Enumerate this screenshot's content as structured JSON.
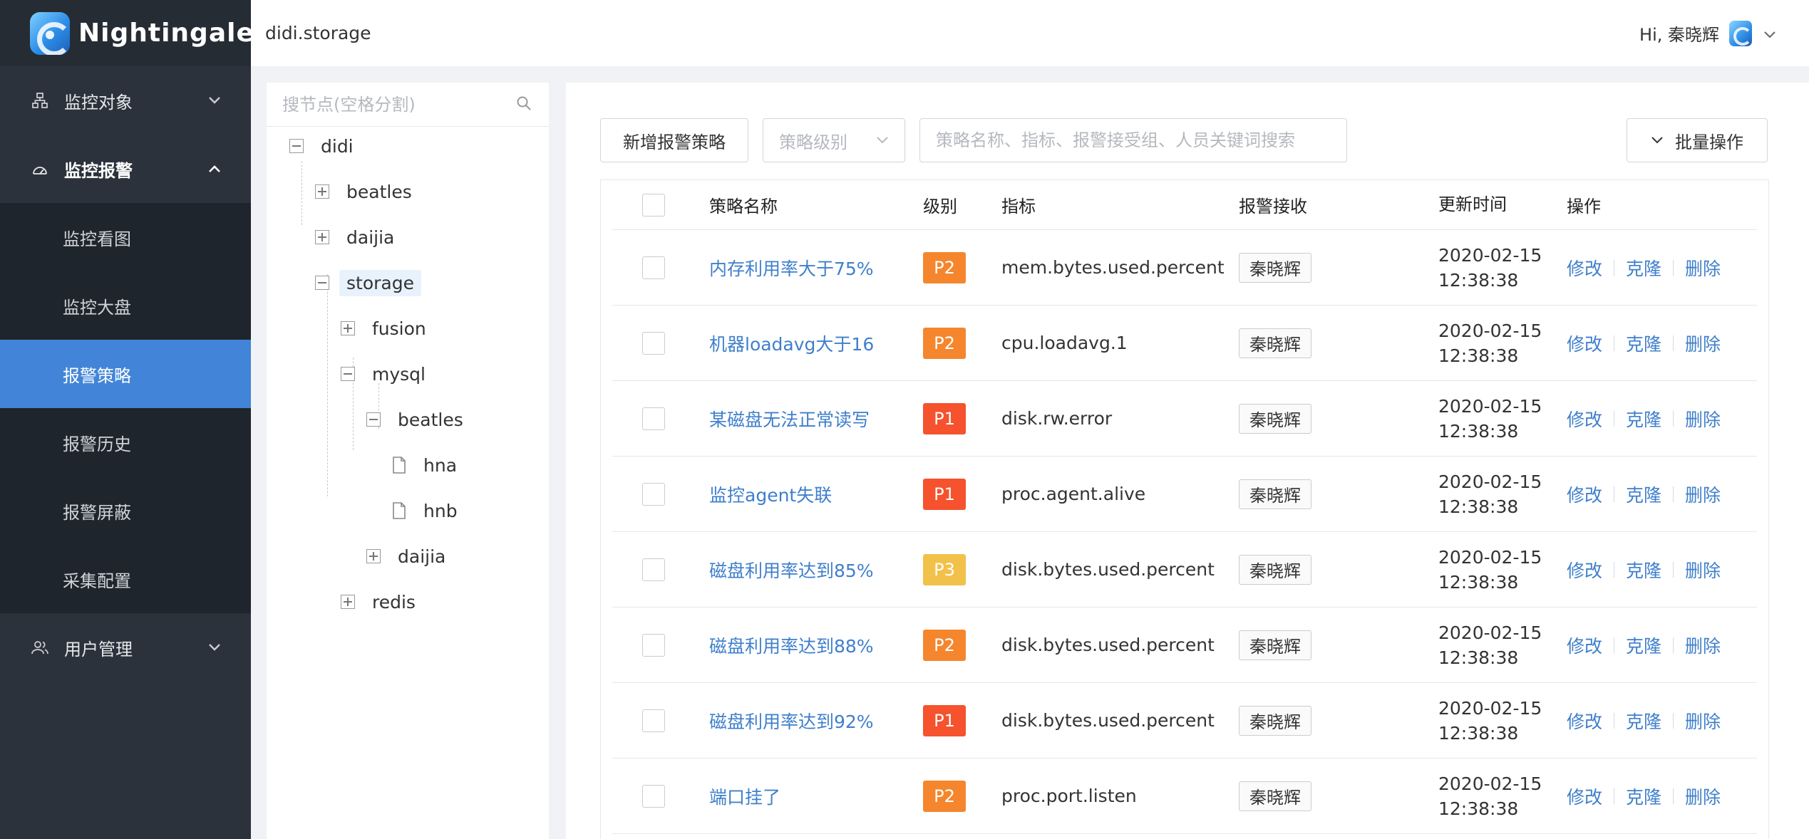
{
  "app": {
    "name": "Nightingale"
  },
  "header": {
    "breadcrumb": "didi.storage",
    "greeting": "Hi, 秦晓辉"
  },
  "sidebar": {
    "groups": [
      {
        "label": "监控对象",
        "icon": "sitemap-icon",
        "expanded": false
      },
      {
        "label": "监控报警",
        "icon": "dashboard-gauge-icon",
        "expanded": true,
        "items": [
          "监控看图",
          "监控大盘",
          "报警策略",
          "报警历史",
          "报警屏蔽",
          "采集配置"
        ],
        "active_item": "报警策略"
      },
      {
        "label": "用户管理",
        "icon": "users-icon",
        "expanded": false
      }
    ]
  },
  "tree": {
    "search_placeholder": "搜节点(空格分割)",
    "nodes": [
      {
        "label": "didi",
        "type": "expanded"
      },
      {
        "label": "beatles",
        "type": "collapsed"
      },
      {
        "label": "daijia",
        "type": "collapsed"
      },
      {
        "label": "storage",
        "type": "expanded",
        "selected": true
      },
      {
        "label": "fusion",
        "type": "collapsed"
      },
      {
        "label": "mysql",
        "type": "expanded"
      },
      {
        "label": "beatles",
        "type": "expanded"
      },
      {
        "label": "hna",
        "type": "leaf"
      },
      {
        "label": "hnb",
        "type": "leaf"
      },
      {
        "label": "daijia",
        "type": "collapsed"
      },
      {
        "label": "redis",
        "type": "collapsed"
      }
    ]
  },
  "toolbar": {
    "add_button": "新增报警策略",
    "level_placeholder": "策略级别",
    "search_placeholder": "策略名称、指标、报警接受组、人员关键词搜索",
    "batch_button": "批量操作"
  },
  "table": {
    "columns": [
      "策略名称",
      "级别",
      "指标",
      "报警接收",
      "更新时间",
      "操作"
    ],
    "actions": [
      "修改",
      "克隆",
      "删除"
    ],
    "level_colors": {
      "P1": "#f5522d",
      "P2": "#f5862d",
      "P3": "#f2c14a"
    },
    "rows": [
      {
        "name": "内存利用率大于75%",
        "level": "P2",
        "metric": "mem.bytes.used.percent",
        "receiver": "秦晓辉",
        "date": "2020-02-15",
        "time": "12:38:38"
      },
      {
        "name": "机器loadavg大于16",
        "level": "P2",
        "metric": "cpu.loadavg.1",
        "receiver": "秦晓辉",
        "date": "2020-02-15",
        "time": "12:38:38"
      },
      {
        "name": "某磁盘无法正常读写",
        "level": "P1",
        "metric": "disk.rw.error",
        "receiver": "秦晓辉",
        "date": "2020-02-15",
        "time": "12:38:38"
      },
      {
        "name": "监控agent失联",
        "level": "P1",
        "metric": "proc.agent.alive",
        "receiver": "秦晓辉",
        "date": "2020-02-15",
        "time": "12:38:38"
      },
      {
        "name": "磁盘利用率达到85%",
        "level": "P3",
        "metric": "disk.bytes.used.percent",
        "receiver": "秦晓辉",
        "date": "2020-02-15",
        "time": "12:38:38"
      },
      {
        "name": "磁盘利用率达到88%",
        "level": "P2",
        "metric": "disk.bytes.used.percent",
        "receiver": "秦晓辉",
        "date": "2020-02-15",
        "time": "12:38:38"
      },
      {
        "name": "磁盘利用率达到92%",
        "level": "P1",
        "metric": "disk.bytes.used.percent",
        "receiver": "秦晓辉",
        "date": "2020-02-15",
        "time": "12:38:38"
      },
      {
        "name": "端口挂了",
        "level": "P2",
        "metric": "proc.port.listen",
        "receiver": "秦晓辉",
        "date": "2020-02-15",
        "time": "12:38:38"
      }
    ]
  },
  "colors": {
    "accent": "#4285d8",
    "link": "#3f7fcb",
    "sidebar_bg": "#2b323b"
  }
}
